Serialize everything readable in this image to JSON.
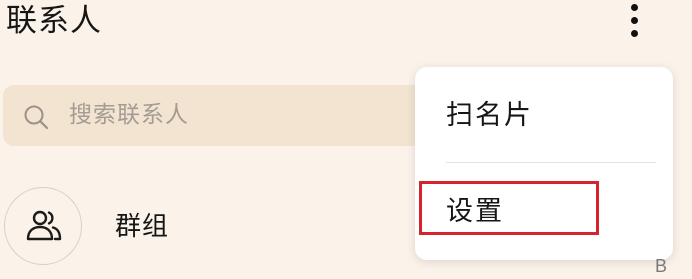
{
  "header": {
    "title": "联系人",
    "more_icon": "more-vertical-icon"
  },
  "search": {
    "placeholder": "搜索联系人",
    "icon": "search-icon"
  },
  "contacts": {
    "group_entry": {
      "label": "群组",
      "icon": "group-people-icon"
    },
    "index_letter": "B"
  },
  "menu": {
    "items": [
      {
        "label": "扫名片"
      },
      {
        "label": "设置",
        "highlighted": true
      }
    ]
  },
  "colors": {
    "background": "#fbf3ea",
    "search_background": "#f3e4d2",
    "menu_background": "#ffffff",
    "highlight_border": "#d6242c",
    "placeholder_text": "#a49c93"
  }
}
